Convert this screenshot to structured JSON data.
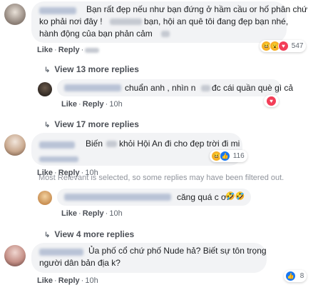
{
  "c1": {
    "line1": "Bạn rất đẹp nếu như bạn đứng ở hầm cầu or hố phân chứ",
    "line2a": "ko phải nơi đây !",
    "line2b": "bạn, hội an quê tôi đang đẹp bạn nhé,",
    "line3": "hành động của bạn phản cảm",
    "like": "Like",
    "reply": "Reply",
    "reactions": "547",
    "colors": {
      "haha": "#f7b125",
      "wow": "#f7b125",
      "love": "#f33e58"
    }
  },
  "v1": "View 13 more replies",
  "r1": {
    "text_a": "chuẩn anh , nhìn n",
    "text_b": "đc cái quần què gì cả",
    "like": "Like",
    "reply": "Reply",
    "time": "10h",
    "reactions": "",
    "colors": {
      "love": "#f33e58"
    }
  },
  "v2": "View 17 more replies",
  "c2": {
    "text_a": "Biến",
    "text_b": "khỏi Hội An đi cho đẹp trời đi mi",
    "like": "Like",
    "reply": "Reply",
    "time": "10h",
    "reactions": "116"
  },
  "filter_note": "Most Relevant is selected, so some replies may have been filtered out.",
  "r2": {
    "text": "căng quá c ơi",
    "emoji": "🤣🤣",
    "like": "Like",
    "reply": "Reply",
    "time": "10h"
  },
  "v3": "View 4 more replies",
  "c3": {
    "line1": "Ủa phố cổ chứ phố Nude hả? Biết sự tôn trọng",
    "line2": "người dân bản địa k?",
    "like": "Like",
    "reply": "Reply",
    "time": "10h",
    "reactions": "8"
  },
  "accent": "#4b4f56",
  "bubble_bg": "#f2f3f5"
}
